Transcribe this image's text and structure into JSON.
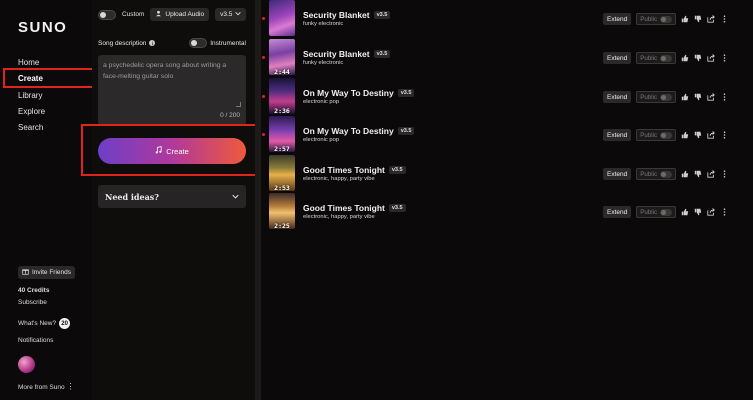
{
  "brand": "SUNO",
  "nav": {
    "home": "Home",
    "create": "Create",
    "library": "Library",
    "explore": "Explore",
    "search": "Search"
  },
  "sidebar": {
    "invite": "Invite Friends",
    "credits": "40 Credits",
    "subscribe": "Subscribe",
    "whats_new": "What's New?",
    "whats_new_count": "20",
    "notifications": "Notifications",
    "more": "More from Suno"
  },
  "create_panel": {
    "custom_label": "Custom",
    "upload_audio": "Upload Audio",
    "version": "v3.5",
    "song_description_label": "Song description",
    "instrumental_label": "Instrumental",
    "description_value": "a psychedelic opera song about writing a face-melting guitar solo",
    "char_count": "0 / 200",
    "create_button": "Create",
    "need_ideas": "Need ideas?"
  },
  "songs": [
    {
      "title": "Security Blanket",
      "version": "v3.5",
      "genre": "funky electronic",
      "duration": "",
      "extend": "Extend",
      "public": "Public"
    },
    {
      "title": "Security Blanket",
      "version": "v3.5",
      "genre": "funky electronic",
      "duration": "2:44",
      "extend": "Extend",
      "public": "Public"
    },
    {
      "title": "On My Way To Destiny",
      "version": "v3.5",
      "genre": "electronic pop",
      "duration": "2:36",
      "extend": "Extend",
      "public": "Public"
    },
    {
      "title": "On My Way To Destiny",
      "version": "v3.5",
      "genre": "electronic pop",
      "duration": "2:57",
      "extend": "Extend",
      "public": "Public"
    },
    {
      "title": "Good Times Tonight",
      "version": "v3.5",
      "genre": "electronic, happy, party vibe",
      "duration": "2:53",
      "extend": "Extend",
      "public": "Public"
    },
    {
      "title": "Good Times Tonight",
      "version": "v3.5",
      "genre": "electronic, happy, party vibe",
      "duration": "2:25",
      "extend": "Extend",
      "public": "Public"
    }
  ],
  "colors": {
    "accent_red": "#e0241c",
    "gradient_start": "#6d3fc7",
    "gradient_end": "#ee5a3b"
  }
}
